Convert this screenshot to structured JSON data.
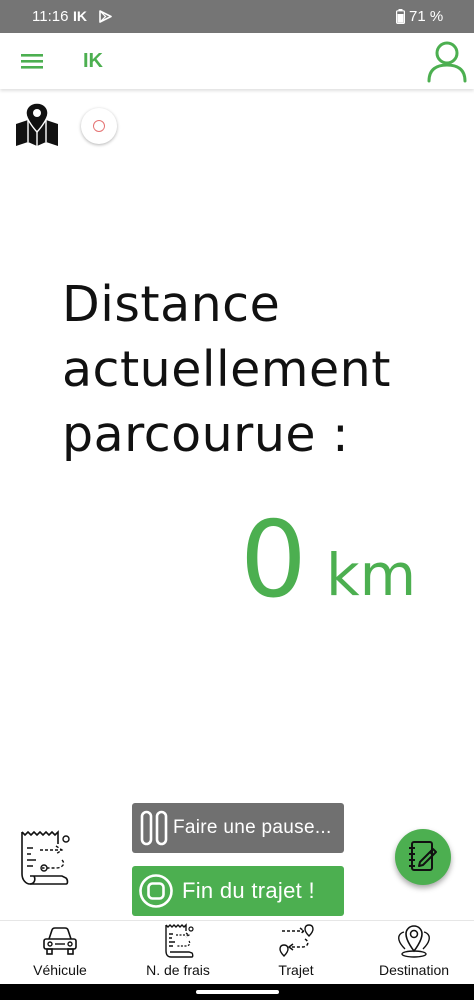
{
  "status_bar": {
    "time": "11:16",
    "app_indicator": "IK",
    "battery": "71 %"
  },
  "app_bar": {
    "title": "IK",
    "menu_icon": "hamburger-menu-icon",
    "profile_icon": "user-profile-icon"
  },
  "tracking": {
    "label": "Distance actuellement parcourue :",
    "distance_value": "0",
    "distance_unit": "km"
  },
  "actions": {
    "pause_label": "Faire une pause...",
    "end_label": "Fin du trajet !"
  },
  "bottom_nav": {
    "items": [
      {
        "label": "Véhicule",
        "icon": "car-icon"
      },
      {
        "label": "N. de frais",
        "icon": "receipt-icon"
      },
      {
        "label": "Trajet",
        "icon": "route-icon"
      },
      {
        "label": "Destination",
        "icon": "map-pins-icon"
      }
    ]
  },
  "colors": {
    "accent": "#4caf50",
    "pause_button": "#707070",
    "status_bar": "#757575",
    "record_ring": "#e57373"
  }
}
